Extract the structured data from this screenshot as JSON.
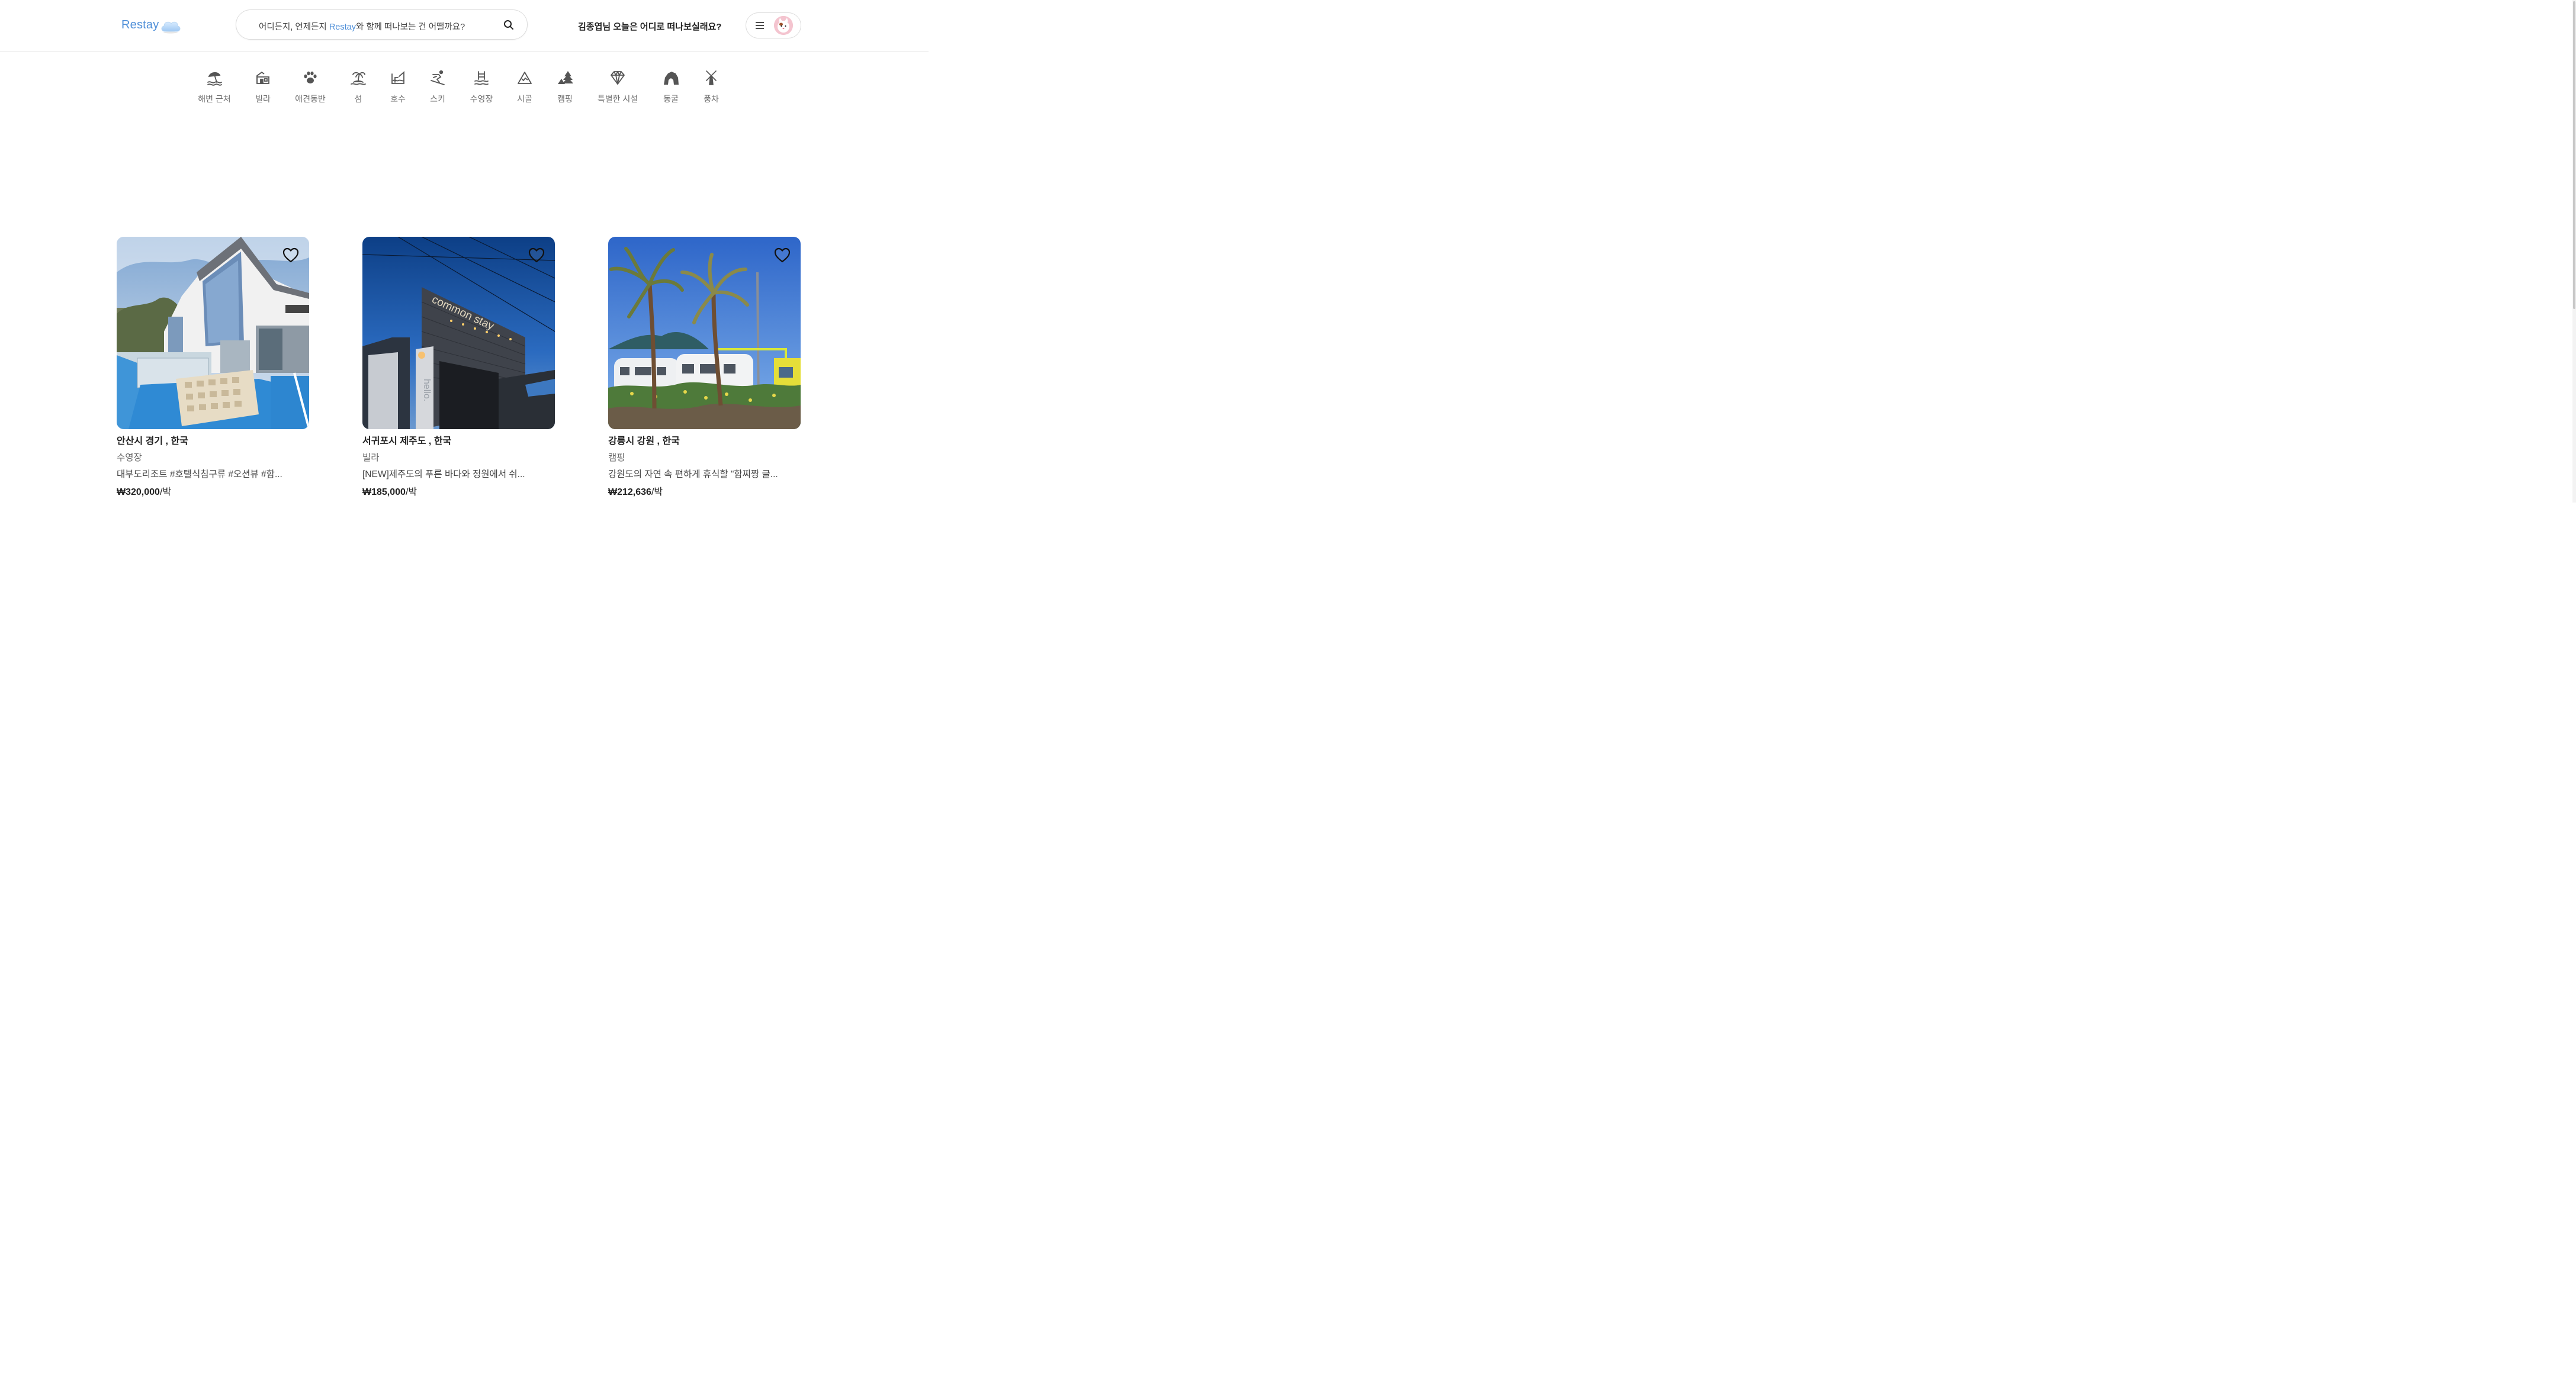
{
  "header": {
    "logo_text": "Restay",
    "search": {
      "text_before": "어디든지, 언제든지 ",
      "brand": "Restay",
      "text_after": "와 함께 떠나보는 건 어떨까요?"
    },
    "greeting": "김종엽님 오늘은 어디로 떠나보실래요?"
  },
  "categories": [
    {
      "label": "해변 근처",
      "icon": "beach-icon"
    },
    {
      "label": "빌라",
      "icon": "villa-icon"
    },
    {
      "label": "애견동반",
      "icon": "paw-icon"
    },
    {
      "label": "섬",
      "icon": "island-icon"
    },
    {
      "label": "호수",
      "icon": "lake-icon"
    },
    {
      "label": "스키",
      "icon": "ski-icon"
    },
    {
      "label": "수영장",
      "icon": "pool-icon"
    },
    {
      "label": "시골",
      "icon": "countryside-icon"
    },
    {
      "label": "캠핑",
      "icon": "camping-icon"
    },
    {
      "label": "특별한 시설",
      "icon": "diamond-icon"
    },
    {
      "label": "동굴",
      "icon": "cave-icon"
    },
    {
      "label": "풍차",
      "icon": "windmill-icon"
    }
  ],
  "listings": [
    {
      "location": "안산시 경기 , 한국",
      "type": "수영장",
      "description": "대부도리조트 #호텔식침구류 #오션뷰 #함...",
      "price": "₩320,000",
      "unit": "/박"
    },
    {
      "location": "서귀포시 제주도 , 한국",
      "type": "빌라",
      "description": "[NEW]제주도의 푸른 바다와 정원에서 쉬...",
      "price": "₩185,000",
      "unit": "/박"
    },
    {
      "location": "강릉시 강원 , 한국",
      "type": "캠핑",
      "description": "강원도의 자연 속 편하게 휴식할 \"함찌짱 글...",
      "price": "₩212,636",
      "unit": "/박"
    }
  ],
  "listing_images": [
    {
      "sign_text": "common stay",
      "wall_text": "hello."
    }
  ],
  "colors": {
    "brand": "#4f8fd8",
    "icon": "#555555"
  }
}
